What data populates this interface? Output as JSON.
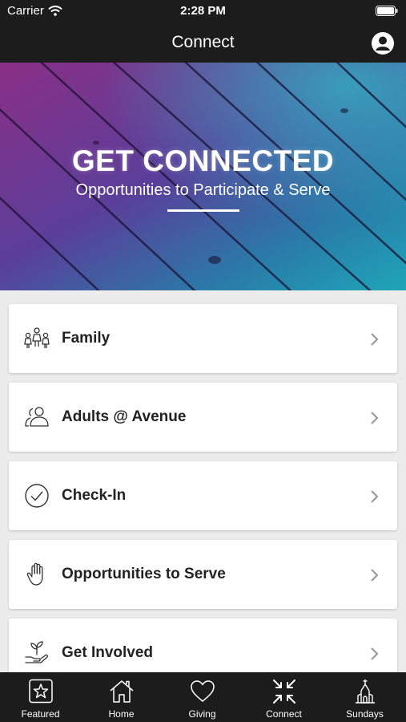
{
  "status_bar": {
    "carrier": "Carrier",
    "time": "2:28 PM"
  },
  "nav": {
    "title": "Connect"
  },
  "hero": {
    "headline": "GET CONNECTED",
    "subline": "Opportunities to Participate & Serve"
  },
  "items": [
    {
      "label": "Family",
      "icon": "family-icon"
    },
    {
      "label": "Adults @ Avenue",
      "icon": "adults-icon"
    },
    {
      "label": "Check-In",
      "icon": "check-circle-icon"
    },
    {
      "label": "Opportunities to Serve",
      "icon": "raised-hand-icon"
    },
    {
      "label": "Get Involved",
      "icon": "hand-plant-icon"
    }
  ],
  "tabs": [
    {
      "label": "Featured",
      "icon": "star-box-icon"
    },
    {
      "label": "Home",
      "icon": "home-icon"
    },
    {
      "label": "Giving",
      "icon": "heart-icon"
    },
    {
      "label": "Connect",
      "icon": "connect-arrows-icon"
    },
    {
      "label": "Sundays",
      "icon": "church-icon"
    }
  ],
  "colors": {
    "bar": "#1c1c1c",
    "background": "#ececec",
    "card": "#ffffff",
    "hero_purple": "#8a2f86",
    "hero_teal": "#1ea6b8"
  }
}
